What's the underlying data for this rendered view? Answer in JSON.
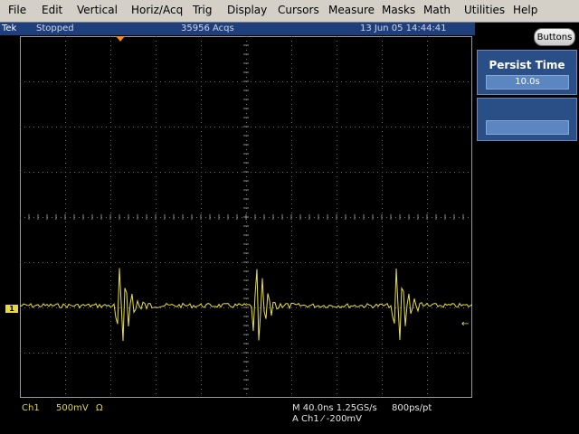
{
  "menu": {
    "file": "File",
    "edit": "Edit",
    "vertical": "Vertical",
    "horiz_acq": "Horiz/Acq",
    "trig": "Trig",
    "display": "Display",
    "cursors": "Cursors",
    "measure": "Measure",
    "masks": "Masks",
    "math": "Math",
    "utilities": "Utilities",
    "help": "Help"
  },
  "status": {
    "brand": "Tek",
    "run_state": "Stopped",
    "acquisitions": "35956 Acqs",
    "datetime": "13 Jun 05 14:44:41"
  },
  "buttons_label": "Buttons",
  "persist": {
    "title": "Persist Time",
    "value": "10.0s"
  },
  "readouts": {
    "channel": "Ch1",
    "volts_per_div": "500mV",
    "coupling_symbol": "Ω",
    "horizontal": "M 40.0ns 1.25GS/s",
    "record_resolution": "800ps/pt",
    "trigger": "A  Ch1  ⁄  -200mV"
  },
  "channel_marker": "1",
  "colors": {
    "trace": "#e8e040",
    "status_bar": "#1e3f7c",
    "menu_bar": "#d4d0c8",
    "panel": "#2a4f86",
    "trigger_marker": "#f08c1e"
  }
}
